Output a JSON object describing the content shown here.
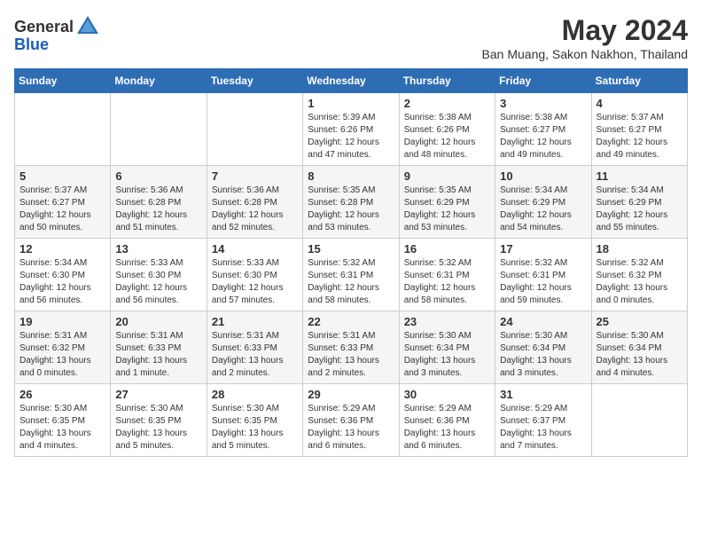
{
  "header": {
    "logo_general": "General",
    "logo_blue": "Blue",
    "month": "May 2024",
    "location": "Ban Muang, Sakon Nakhon, Thailand"
  },
  "weekdays": [
    "Sunday",
    "Monday",
    "Tuesday",
    "Wednesday",
    "Thursday",
    "Friday",
    "Saturday"
  ],
  "weeks": [
    [
      {
        "day": "",
        "info": ""
      },
      {
        "day": "",
        "info": ""
      },
      {
        "day": "",
        "info": ""
      },
      {
        "day": "1",
        "info": "Sunrise: 5:39 AM\nSunset: 6:26 PM\nDaylight: 12 hours\nand 47 minutes."
      },
      {
        "day": "2",
        "info": "Sunrise: 5:38 AM\nSunset: 6:26 PM\nDaylight: 12 hours\nand 48 minutes."
      },
      {
        "day": "3",
        "info": "Sunrise: 5:38 AM\nSunset: 6:27 PM\nDaylight: 12 hours\nand 49 minutes."
      },
      {
        "day": "4",
        "info": "Sunrise: 5:37 AM\nSunset: 6:27 PM\nDaylight: 12 hours\nand 49 minutes."
      }
    ],
    [
      {
        "day": "5",
        "info": "Sunrise: 5:37 AM\nSunset: 6:27 PM\nDaylight: 12 hours\nand 50 minutes."
      },
      {
        "day": "6",
        "info": "Sunrise: 5:36 AM\nSunset: 6:28 PM\nDaylight: 12 hours\nand 51 minutes."
      },
      {
        "day": "7",
        "info": "Sunrise: 5:36 AM\nSunset: 6:28 PM\nDaylight: 12 hours\nand 52 minutes."
      },
      {
        "day": "8",
        "info": "Sunrise: 5:35 AM\nSunset: 6:28 PM\nDaylight: 12 hours\nand 53 minutes."
      },
      {
        "day": "9",
        "info": "Sunrise: 5:35 AM\nSunset: 6:29 PM\nDaylight: 12 hours\nand 53 minutes."
      },
      {
        "day": "10",
        "info": "Sunrise: 5:34 AM\nSunset: 6:29 PM\nDaylight: 12 hours\nand 54 minutes."
      },
      {
        "day": "11",
        "info": "Sunrise: 5:34 AM\nSunset: 6:29 PM\nDaylight: 12 hours\nand 55 minutes."
      }
    ],
    [
      {
        "day": "12",
        "info": "Sunrise: 5:34 AM\nSunset: 6:30 PM\nDaylight: 12 hours\nand 56 minutes."
      },
      {
        "day": "13",
        "info": "Sunrise: 5:33 AM\nSunset: 6:30 PM\nDaylight: 12 hours\nand 56 minutes."
      },
      {
        "day": "14",
        "info": "Sunrise: 5:33 AM\nSunset: 6:30 PM\nDaylight: 12 hours\nand 57 minutes."
      },
      {
        "day": "15",
        "info": "Sunrise: 5:32 AM\nSunset: 6:31 PM\nDaylight: 12 hours\nand 58 minutes."
      },
      {
        "day": "16",
        "info": "Sunrise: 5:32 AM\nSunset: 6:31 PM\nDaylight: 12 hours\nand 58 minutes."
      },
      {
        "day": "17",
        "info": "Sunrise: 5:32 AM\nSunset: 6:31 PM\nDaylight: 12 hours\nand 59 minutes."
      },
      {
        "day": "18",
        "info": "Sunrise: 5:32 AM\nSunset: 6:32 PM\nDaylight: 13 hours\nand 0 minutes."
      }
    ],
    [
      {
        "day": "19",
        "info": "Sunrise: 5:31 AM\nSunset: 6:32 PM\nDaylight: 13 hours\nand 0 minutes."
      },
      {
        "day": "20",
        "info": "Sunrise: 5:31 AM\nSunset: 6:33 PM\nDaylight: 13 hours\nand 1 minute."
      },
      {
        "day": "21",
        "info": "Sunrise: 5:31 AM\nSunset: 6:33 PM\nDaylight: 13 hours\nand 2 minutes."
      },
      {
        "day": "22",
        "info": "Sunrise: 5:31 AM\nSunset: 6:33 PM\nDaylight: 13 hours\nand 2 minutes."
      },
      {
        "day": "23",
        "info": "Sunrise: 5:30 AM\nSunset: 6:34 PM\nDaylight: 13 hours\nand 3 minutes."
      },
      {
        "day": "24",
        "info": "Sunrise: 5:30 AM\nSunset: 6:34 PM\nDaylight: 13 hours\nand 3 minutes."
      },
      {
        "day": "25",
        "info": "Sunrise: 5:30 AM\nSunset: 6:34 PM\nDaylight: 13 hours\nand 4 minutes."
      }
    ],
    [
      {
        "day": "26",
        "info": "Sunrise: 5:30 AM\nSunset: 6:35 PM\nDaylight: 13 hours\nand 4 minutes."
      },
      {
        "day": "27",
        "info": "Sunrise: 5:30 AM\nSunset: 6:35 PM\nDaylight: 13 hours\nand 5 minutes."
      },
      {
        "day": "28",
        "info": "Sunrise: 5:30 AM\nSunset: 6:35 PM\nDaylight: 13 hours\nand 5 minutes."
      },
      {
        "day": "29",
        "info": "Sunrise: 5:29 AM\nSunset: 6:36 PM\nDaylight: 13 hours\nand 6 minutes."
      },
      {
        "day": "30",
        "info": "Sunrise: 5:29 AM\nSunset: 6:36 PM\nDaylight: 13 hours\nand 6 minutes."
      },
      {
        "day": "31",
        "info": "Sunrise: 5:29 AM\nSunset: 6:37 PM\nDaylight: 13 hours\nand 7 minutes."
      },
      {
        "day": "",
        "info": ""
      }
    ]
  ]
}
